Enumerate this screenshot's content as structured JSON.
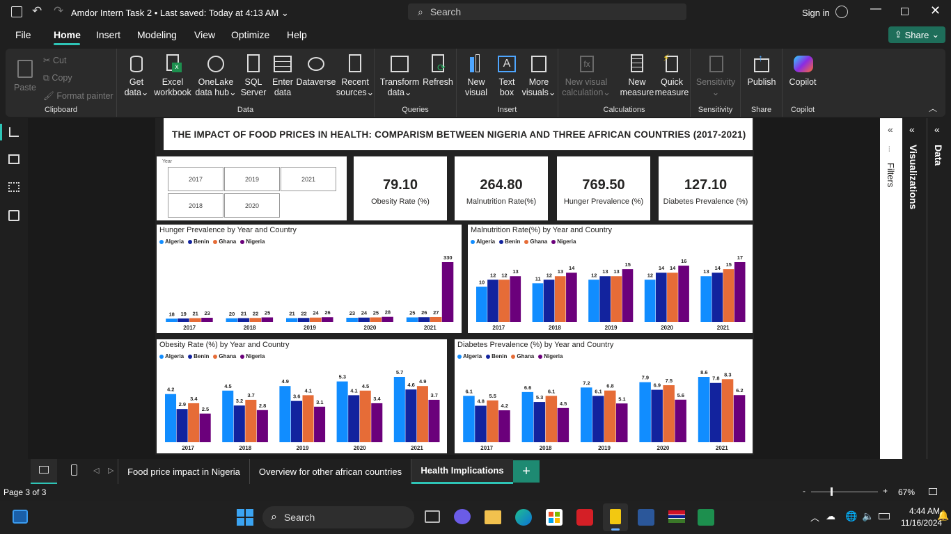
{
  "titlebar": {
    "file_name": "Amdor Intern Task 2",
    "saved": "Last saved: Today at 4:13 AM",
    "search_placeholder": "Search",
    "sign_in": "Sign in"
  },
  "menu": [
    "File",
    "Home",
    "Insert",
    "Modeling",
    "View",
    "Optimize",
    "Help"
  ],
  "share_label": "Share",
  "ribbon": {
    "clipboard": {
      "label": "Clipboard",
      "paste": "Paste",
      "cut": "Cut",
      "copy": "Copy",
      "format_painter": "Format painter"
    },
    "data": {
      "label": "Data",
      "get_data": [
        "Get",
        "data"
      ],
      "excel": [
        "Excel",
        "workbook"
      ],
      "onelake": [
        "OneLake",
        "data hub"
      ],
      "sql": [
        "SQL",
        "Server"
      ],
      "enter": [
        "Enter",
        "data"
      ],
      "dataverse": [
        "Dataverse",
        ""
      ],
      "recent": [
        "Recent",
        "sources"
      ]
    },
    "queries": {
      "label": "Queries",
      "transform": [
        "Transform",
        "data"
      ],
      "refresh": [
        "Refresh",
        ""
      ]
    },
    "insert": {
      "label": "Insert",
      "new_visual": [
        "New",
        "visual"
      ],
      "text_box": [
        "Text",
        "box"
      ],
      "more_visuals": [
        "More",
        "visuals"
      ]
    },
    "calculations": {
      "label": "Calculations",
      "new_visual_calc": [
        "New visual",
        "calculation"
      ],
      "new_measure": [
        "New",
        "measure"
      ],
      "quick_measure": [
        "Quick",
        "measure"
      ]
    },
    "sensitivity": {
      "label": "Sensitivity",
      "btn": [
        "Sensitivity",
        ""
      ]
    },
    "share": {
      "label": "Share",
      "publish": [
        "Publish",
        ""
      ]
    },
    "copilot": {
      "label": "Copilot",
      "btn": [
        "Copilot",
        ""
      ]
    }
  },
  "report": {
    "title": "THE IMPACT OF FOOD PRICES IN HEALTH: COMPARISM BETWEEN NIGERIA AND THREE AFRICAN COUNTRIES (2017-2021)",
    "slicer": {
      "label": "Year",
      "years": [
        "2017",
        "2019",
        "2021",
        "2018",
        "2020"
      ]
    },
    "kpis": [
      {
        "value": "79.10",
        "label": "Obesity Rate (%)"
      },
      {
        "value": "264.80",
        "label": "Malnutrition Rate(%)"
      },
      {
        "value": "769.50",
        "label": "Hunger Prevalence (%)"
      },
      {
        "value": "127.10",
        "label": "Diabetes Prevalence (%)"
      }
    ]
  },
  "colors": {
    "Algeria": "#118dff",
    "Benin": "#12239e",
    "Ghana": "#e66c37",
    "Nigeria": "#6b007b"
  },
  "chart_data": [
    {
      "type": "bar",
      "title": "Hunger Prevalence by Year and Country",
      "categories": [
        "2017",
        "2018",
        "2019",
        "2020",
        "2021"
      ],
      "series": [
        {
          "name": "Algeria",
          "values": [
            18,
            20,
            21,
            23,
            25
          ]
        },
        {
          "name": "Benin",
          "values": [
            19,
            21,
            22,
            24,
            26
          ]
        },
        {
          "name": "Ghana",
          "values": [
            21,
            22,
            24,
            25,
            27
          ]
        },
        {
          "name": "Nigeria",
          "values": [
            23,
            25,
            26,
            28,
            330
          ]
        }
      ],
      "labels": [
        [
          "18",
          "19",
          "21",
          "23"
        ],
        [
          "20",
          "21",
          "22",
          "25"
        ],
        [
          "21",
          "22",
          "24",
          "26"
        ],
        [
          "23",
          "24",
          "25",
          "28"
        ],
        [
          "25",
          "26",
          "27",
          "330"
        ]
      ],
      "legend": "top-left"
    },
    {
      "type": "bar",
      "title": "Malnutrition Rate(%) by Year and Country",
      "categories": [
        "2017",
        "2018",
        "2019",
        "2020",
        "2021"
      ],
      "series": [
        {
          "name": "Algeria",
          "values": [
            10,
            11,
            12,
            12,
            13
          ]
        },
        {
          "name": "Benin",
          "values": [
            12,
            12,
            13,
            14,
            14
          ]
        },
        {
          "name": "Ghana",
          "values": [
            12,
            13,
            13,
            14,
            15
          ]
        },
        {
          "name": "Nigeria",
          "values": [
            13,
            14,
            15,
            16,
            17
          ]
        }
      ],
      "labels": [
        [
          "10",
          "12",
          "12",
          "13"
        ],
        [
          "11",
          "12",
          "13",
          "14"
        ],
        [
          "12",
          "13",
          "13",
          "15"
        ],
        [
          "12",
          "14",
          "14",
          "16"
        ],
        [
          "13",
          "14",
          "15",
          "17"
        ]
      ],
      "legend": "top-left"
    },
    {
      "type": "bar",
      "title": "Obesity Rate (%) by Year and Country",
      "categories": [
        "2017",
        "2018",
        "2019",
        "2020",
        "2021"
      ],
      "series": [
        {
          "name": "Algeria",
          "values": [
            4.2,
            4.5,
            4.9,
            5.3,
            5.7
          ]
        },
        {
          "name": "Benin",
          "values": [
            2.9,
            3.2,
            3.6,
            4.1,
            4.6
          ]
        },
        {
          "name": "Ghana",
          "values": [
            3.4,
            3.7,
            4.1,
            4.5,
            4.9
          ]
        },
        {
          "name": "Nigeria",
          "values": [
            2.5,
            2.8,
            3.1,
            3.4,
            3.7
          ]
        }
      ],
      "labels": [
        [
          "4.2",
          "2.9",
          "3.4",
          "2.5"
        ],
        [
          "4.5",
          "3.2",
          "3.7",
          "2.8"
        ],
        [
          "4.9",
          "3.6",
          "4.1",
          "3.1"
        ],
        [
          "5.3",
          "4.1",
          "4.5",
          "3.4"
        ],
        [
          "5.7",
          "4.6",
          "4.9",
          "3.7"
        ]
      ],
      "legend": "top-left"
    },
    {
      "type": "bar",
      "title": "Diabetes Prevalence (%) by Year and Country",
      "categories": [
        "2017",
        "2018",
        "2019",
        "2020",
        "2021"
      ],
      "series": [
        {
          "name": "Algeria",
          "values": [
            6.1,
            6.6,
            7.2,
            7.9,
            8.6
          ]
        },
        {
          "name": "Benin",
          "values": [
            4.8,
            5.3,
            6.1,
            6.9,
            7.8
          ]
        },
        {
          "name": "Ghana",
          "values": [
            5.5,
            6.1,
            6.8,
            7.5,
            8.3
          ]
        },
        {
          "name": "Nigeria",
          "values": [
            4.2,
            4.5,
            5.1,
            5.6,
            6.2
          ]
        }
      ],
      "labels": [
        [
          "6.1",
          "4.8",
          "5.5",
          "4.2"
        ],
        [
          "6.6",
          "5.3",
          "6.1",
          "4.5"
        ],
        [
          "7.2",
          "6.1",
          "6.8",
          "5.1"
        ],
        [
          "7.9",
          "6.9",
          "7.5",
          "5.6"
        ],
        [
          "8.6",
          "7.8",
          "8.3",
          "6.2"
        ]
      ],
      "legend": "top-left"
    }
  ],
  "panes": {
    "filters": "Filters",
    "visualizations": "Visualizations",
    "data": "Data"
  },
  "tabs": [
    "Food price impact in Nigeria",
    "Overview for other african countries",
    "Health Implications"
  ],
  "status": {
    "page": "Page 3 of 3",
    "zoom": "67%"
  },
  "taskbar": {
    "search": "Search",
    "time": "4:44 AM",
    "date": "11/16/2024"
  }
}
